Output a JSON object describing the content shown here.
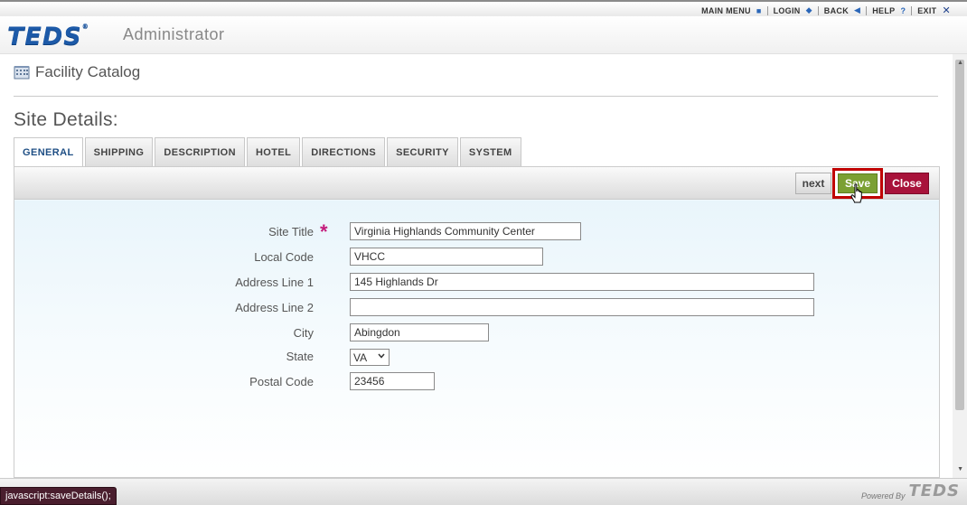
{
  "topnav": {
    "items": [
      {
        "label": "MAIN MENU",
        "icon": "square-icon"
      },
      {
        "label": "LOGIN",
        "icon": "diamond-icon"
      },
      {
        "label": "BACK",
        "icon": "triangle-left-icon"
      },
      {
        "label": "HELP",
        "icon": "question-icon"
      },
      {
        "label": "EXIT",
        "icon": "x-icon"
      }
    ]
  },
  "header": {
    "logo": "TEDS",
    "title": "Administrator"
  },
  "breadcrumb": {
    "title": "Facility Catalog"
  },
  "page": {
    "heading": "Site Details:"
  },
  "tabs": [
    "GENERAL",
    "SHIPPING",
    "DESCRIPTION",
    "HOTEL",
    "DIRECTIONS",
    "SECURITY",
    "SYSTEM"
  ],
  "active_tab": "GENERAL",
  "toolbar": {
    "next_label": "next",
    "save_label": "Save",
    "close_label": "Close"
  },
  "form": {
    "site_title": {
      "label": "Site Title",
      "value": "Virginia Highlands Community Center",
      "required_mark": "*"
    },
    "local_code": {
      "label": "Local Code",
      "value": "VHCC"
    },
    "address_line1": {
      "label": "Address Line 1",
      "value": "145 Highlands Dr"
    },
    "address_line2": {
      "label": "Address Line 2",
      "value": ""
    },
    "city": {
      "label": "City",
      "value": "Abingdon"
    },
    "state": {
      "label": "State",
      "value": "VA"
    },
    "postal_code": {
      "label": "Postal Code",
      "value": "23456"
    }
  },
  "status_bar": {
    "text": "javascript:saveDetails();"
  },
  "footer": {
    "powered_by": "Powered By",
    "logo": "TEDS"
  },
  "colors": {
    "brand_blue": "#1d5aa8",
    "save_green": "#7ba033",
    "close_red": "#a8123a",
    "highlight_red": "#c00000",
    "required_magenta": "#c41c7c"
  }
}
